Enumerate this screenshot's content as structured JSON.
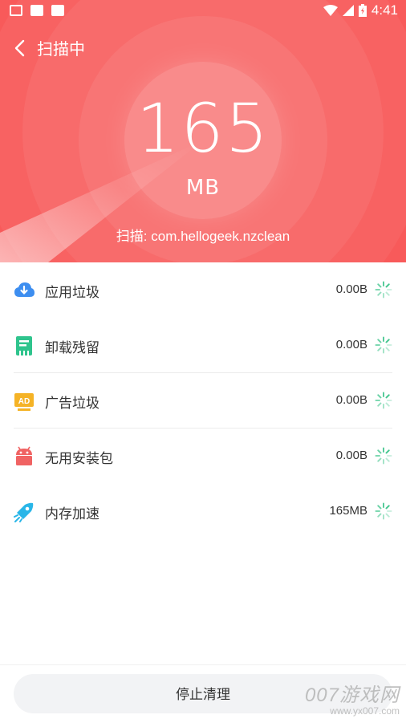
{
  "status_bar": {
    "time": "4:41"
  },
  "header": {
    "title": "扫描中",
    "size_value": "165",
    "size_unit": "MB",
    "scan_status": "扫描: com.hellogeek.nzclean",
    "color": "#f85a5a"
  },
  "items": [
    {
      "label": "应用垃圾",
      "value": "0.00B",
      "icon": "cloud-download-icon",
      "color": "#3d8ef0"
    },
    {
      "label": "卸载残留",
      "value": "0.00B",
      "icon": "uninstall-residue-icon",
      "color": "#2fc48d"
    },
    {
      "label": "广告垃圾",
      "value": "0.00B",
      "icon": "ad-icon",
      "color": "#f5b326"
    },
    {
      "label": "无用安装包",
      "value": "0.00B",
      "icon": "android-icon",
      "color": "#f06363"
    },
    {
      "label": "内存加速",
      "value": "165MB",
      "icon": "rocket-icon",
      "color": "#29b6e8"
    }
  ],
  "stop_button": {
    "label": "停止清理"
  },
  "watermark": {
    "main": "007游戏网",
    "url": "www.yx007.com"
  }
}
